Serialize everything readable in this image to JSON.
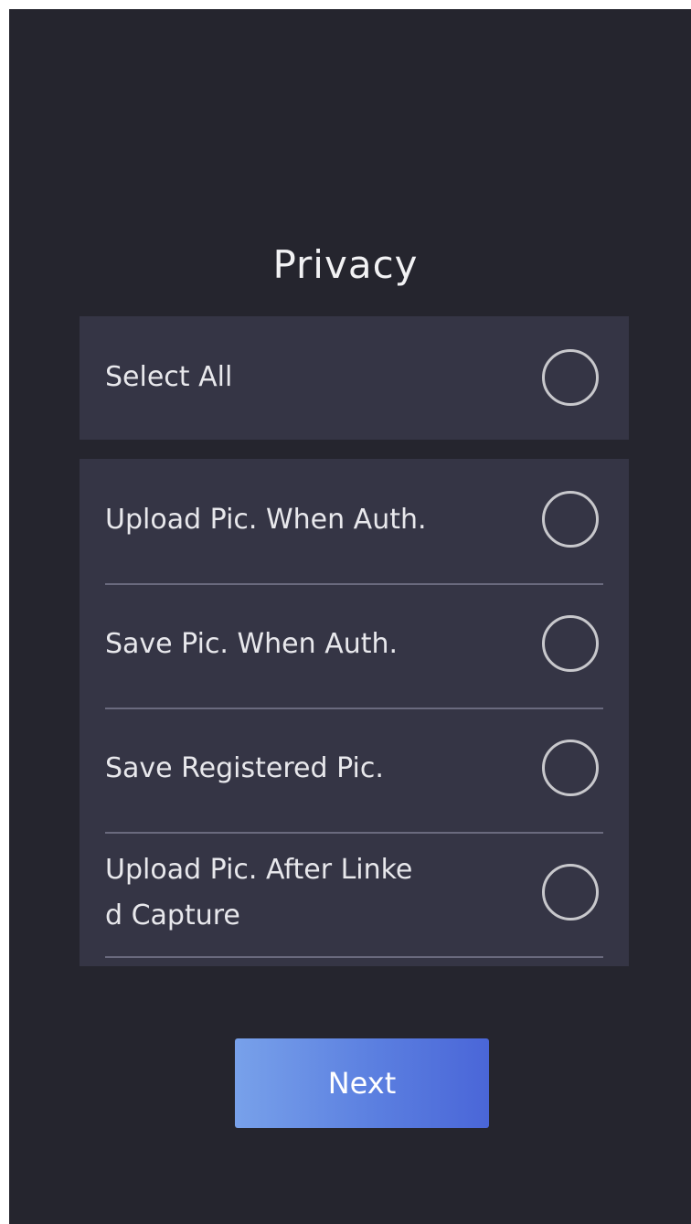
{
  "page": {
    "title": "Privacy"
  },
  "select_all": {
    "label": "Select All",
    "checked": false
  },
  "options": [
    {
      "label": "Upload Pic. When Auth.",
      "checked": false
    },
    {
      "label": "Save Pic. When Auth.",
      "checked": false
    },
    {
      "label": "Save Registered Pic.",
      "checked": false
    },
    {
      "label": "Upload Pic. After Linke\nd Capture",
      "checked": false
    }
  ],
  "actions": {
    "next_label": "Next"
  },
  "colors": {
    "background": "#25252e",
    "card": "#353545",
    "divider": "#6a6a7e",
    "radio_border": "#c8c8cc",
    "button_gradient_start": "#78a1ea",
    "button_gradient_end": "#4a66d8"
  }
}
